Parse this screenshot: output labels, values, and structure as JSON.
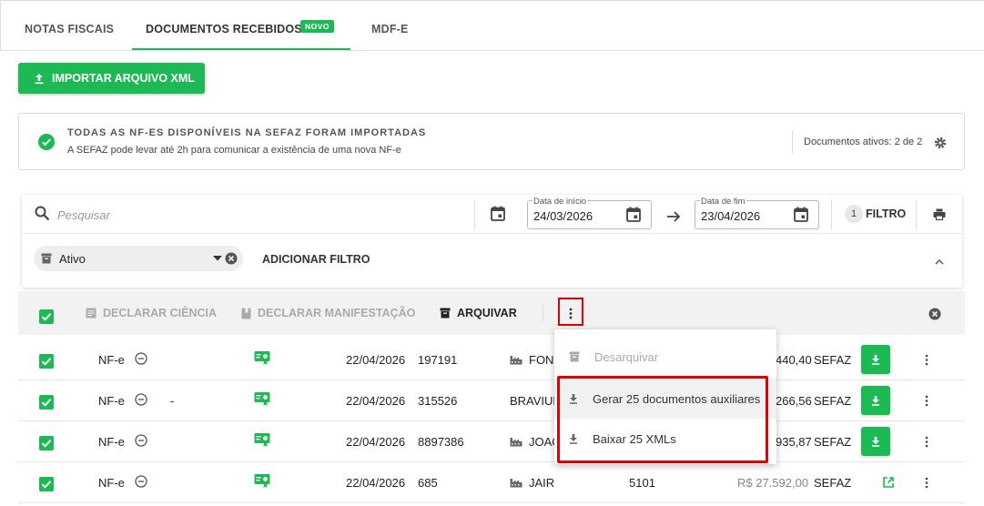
{
  "tabs": [
    {
      "label": "NOTAS FISCAIS"
    },
    {
      "label": "DOCUMENTOS RECEBIDOS",
      "badge": "NOVO"
    },
    {
      "label": "MDF-E"
    }
  ],
  "import_button": {
    "label": "IMPORTAR ARQUIVO XML"
  },
  "info": {
    "title": "TODAS AS NF-ES DISPONÍVEIS NA SEFAZ FORAM IMPORTADAS",
    "subtitle": "A SEFAZ pode levar até 2h para comunicar a existência de uma nova NF-e",
    "docs_active": "Documentos ativos: 2 de 2"
  },
  "search": {
    "placeholder": "Pesquisar"
  },
  "date_start": {
    "label": "Data de início",
    "value": "24/03/2026"
  },
  "date_end": {
    "label": "Data de fim",
    "value": "23/04/2026"
  },
  "filter": {
    "count": "1",
    "label": "FILTRO"
  },
  "status_chip": {
    "label": "Ativo"
  },
  "add_filter": "ADICIONAR FILTRO",
  "actions": {
    "ciencia": "DECLARAR CIÊNCIA",
    "manifestacao": "DECLARAR MANIFESTAÇÃO",
    "arquivar": "ARQUIVAR"
  },
  "menu": {
    "desarquivar": "Desarquivar",
    "gerar": "Gerar 25 documentos auxiliares",
    "baixar": "Baixar 25 XMLs"
  },
  "rows": [
    {
      "tipo": "NF-e",
      "extra": "",
      "data": "22/04/2026",
      "numero": "197191",
      "emitente": "FONS",
      "cfop": "",
      "valor": "440,40",
      "origem": "SEFAZ"
    },
    {
      "tipo": "NF-e",
      "extra": "-",
      "data": "22/04/2026",
      "numero": "315526",
      "emitente": "BRAVIUN",
      "cfop": "",
      "valor": "266,56",
      "origem": "SEFAZ"
    },
    {
      "tipo": "NF-e",
      "extra": "",
      "data": "22/04/2026",
      "numero": "8897386",
      "emitente": "JOAQ",
      "cfop": "",
      "valor": "935,87",
      "origem": "SEFAZ"
    },
    {
      "tipo": "NF-e",
      "extra": "",
      "data": "22/04/2026",
      "numero": "685",
      "emitente": "JAIR",
      "cfop": "5101",
      "valor": "R$ 27.592,00",
      "origem": "SEFAZ"
    }
  ],
  "colors": {
    "accent": "#1db954",
    "highlight": "#e30000"
  }
}
